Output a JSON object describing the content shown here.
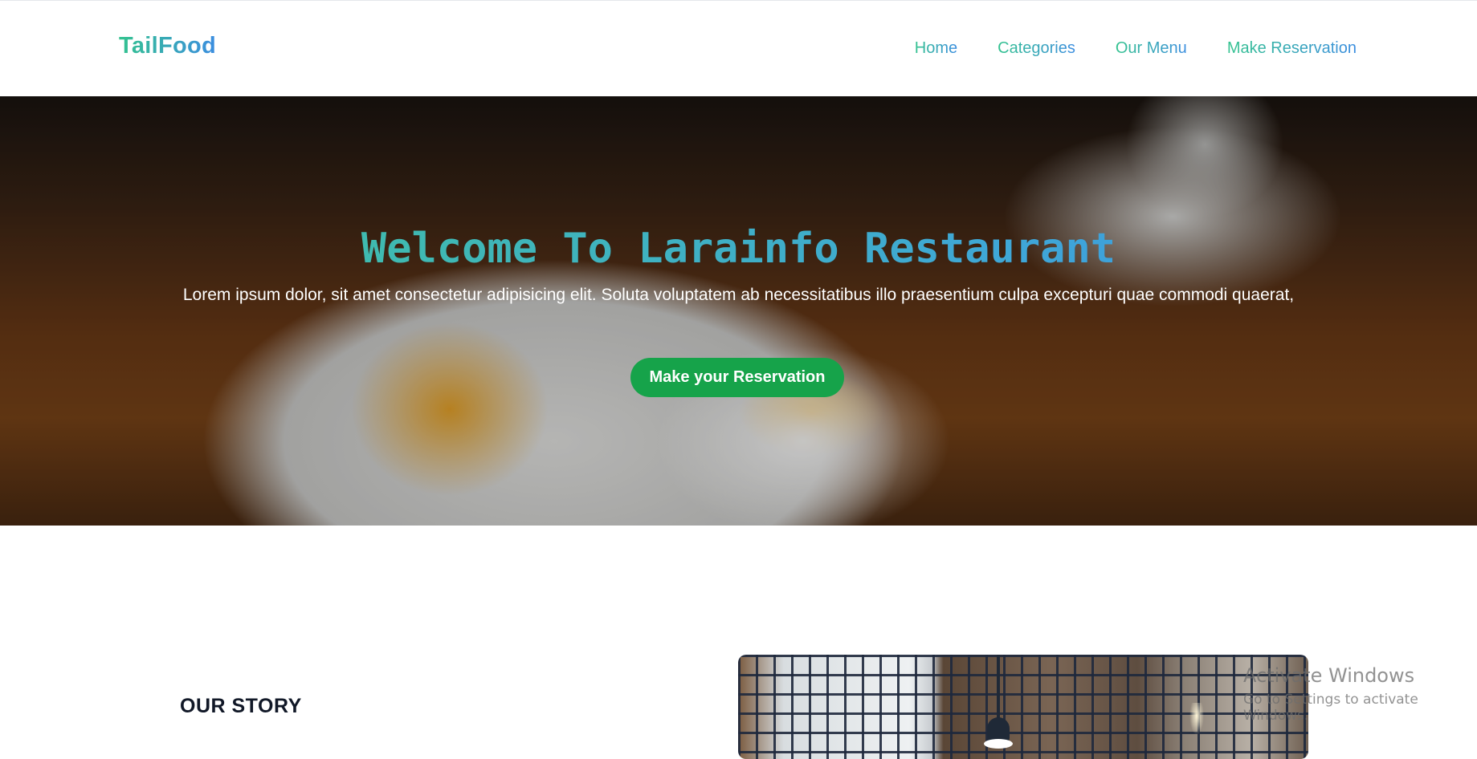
{
  "header": {
    "logo": "TailFood",
    "nav": [
      {
        "label": "Home"
      },
      {
        "label": "Categories"
      },
      {
        "label": "Our Menu"
      },
      {
        "label": "Make Reservation"
      }
    ]
  },
  "hero": {
    "title": "Welcome To Larainfo Restaurant",
    "subtitle": "Lorem ipsum dolor, sit amet consectetur adipisicing elit. Soluta voluptatem ab necessitatibus illo praesentium culpa excepturi quae commodi quaerat,",
    "button_label": "Make your Reservation"
  },
  "story": {
    "title": "OUR STORY"
  },
  "watermark": {
    "title": "Activate Windows",
    "subtitle": "Go to Settings to activate Windows."
  },
  "colors": {
    "accent_green": "#34c38f",
    "accent_blue": "#3b8de0",
    "button_green": "#16a34a"
  }
}
